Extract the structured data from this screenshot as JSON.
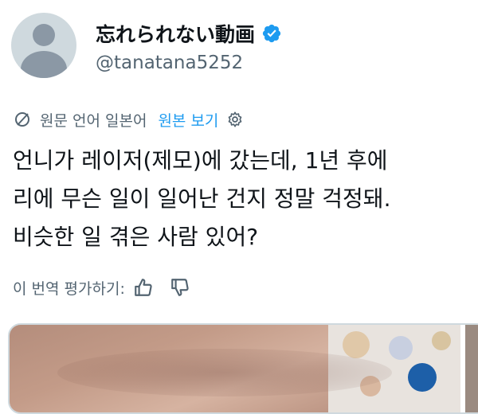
{
  "user": {
    "display_name": "忘れられない動画",
    "handle": "@tanatana5252"
  },
  "translation": {
    "source_language_text": "원문 언어 일본어",
    "show_original_link": "원본 보기"
  },
  "tweet": {
    "lines": [
      "언니가 레이저(제모)에 갔는데, 1년 후에",
      "리에 무슨 일이 일어난 건지 정말 걱정돼.",
      "비슷한 일 겪은 사람 있어?"
    ]
  },
  "rating": {
    "label": "이 번역 평가하기:"
  },
  "colors": {
    "accent": "#1d9bf0",
    "secondary_text": "#536471",
    "primary_text": "#0f1419"
  },
  "icons": {
    "verified": "verified-badge-icon",
    "translate": "translate-icon",
    "settings": "gear-icon",
    "thumbs_up": "thumbs-up-icon",
    "thumbs_down": "thumbs-down-icon"
  }
}
